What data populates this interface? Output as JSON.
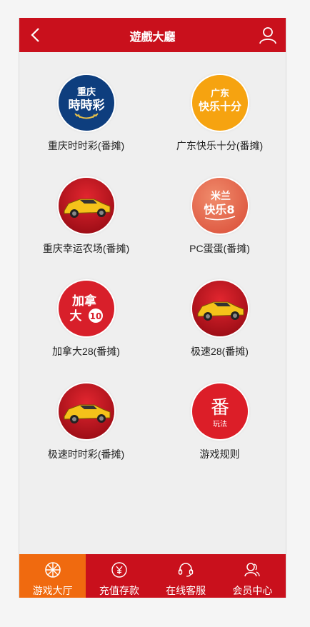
{
  "header": {
    "title": "遊戲大廳"
  },
  "games": [
    {
      "label": "重庆时时彩(番摊)",
      "icon": "cq-ssc-logo",
      "logo_text": [
        "重庆",
        "時時彩"
      ]
    },
    {
      "label": "广东快乐十分(番摊)",
      "icon": "gd-klsf-logo",
      "logo_text": [
        "广东",
        "快乐十分"
      ]
    },
    {
      "label": "重庆幸运农场(番摊)",
      "icon": "sports-car-icon"
    },
    {
      "label": "PC蛋蛋(番摊)",
      "icon": "pc-dandan-logo",
      "logo_text": [
        "米兰",
        "快乐8"
      ]
    },
    {
      "label": "加拿大28(番摊)",
      "icon": "canada-28-logo",
      "logo_text": [
        "加拿",
        "大",
        "10"
      ]
    },
    {
      "label": "极速28(番摊)",
      "icon": "sports-car-icon"
    },
    {
      "label": "极速时时彩(番摊)",
      "icon": "sports-car-icon"
    },
    {
      "label": "游戏规则",
      "icon": "rules-logo",
      "logo_text": [
        "番",
        "玩法"
      ]
    }
  ],
  "tabs": [
    {
      "label": "游戏大厅",
      "icon": "wheel-icon",
      "active": true
    },
    {
      "label": "充值存款",
      "icon": "yen-coin-icon",
      "active": false
    },
    {
      "label": "在线客服",
      "icon": "headset-icon",
      "active": false
    },
    {
      "label": "会员中心",
      "icon": "members-icon",
      "active": false
    }
  ],
  "colors": {
    "brand_red": "#c9101c",
    "active_orange": "#f06a0f",
    "background": "#efefef"
  }
}
